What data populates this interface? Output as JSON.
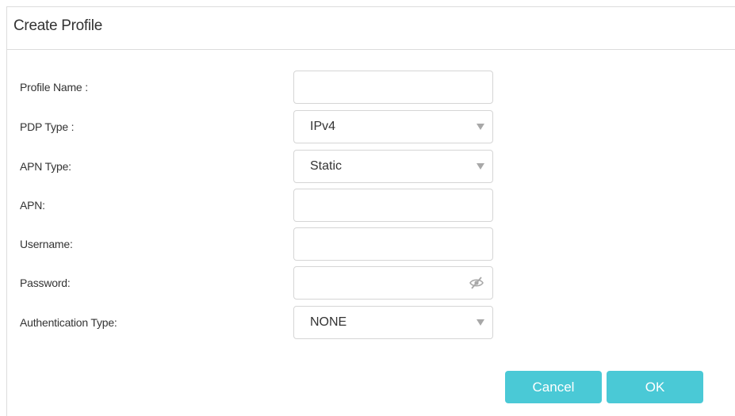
{
  "dialog": {
    "title": "Create Profile"
  },
  "form": {
    "profile_name": {
      "label": "Profile Name :",
      "value": ""
    },
    "pdp_type": {
      "label": "PDP Type :",
      "value": "IPv4"
    },
    "apn_type": {
      "label": "APN Type:",
      "value": "Static"
    },
    "apn": {
      "label": "APN:",
      "value": ""
    },
    "username": {
      "label": "Username:",
      "value": ""
    },
    "password": {
      "label": "Password:",
      "value": ""
    },
    "auth_type": {
      "label": "Authentication Type:",
      "value": "NONE"
    }
  },
  "buttons": {
    "cancel": "Cancel",
    "ok": "OK"
  },
  "colors": {
    "button_accent": "#4ac9d6",
    "border": "#d5d5d5",
    "text": "#333333"
  },
  "icons": {
    "select_arrow": "chevron-down-icon",
    "password_toggle": "eye-hidden-icon"
  }
}
